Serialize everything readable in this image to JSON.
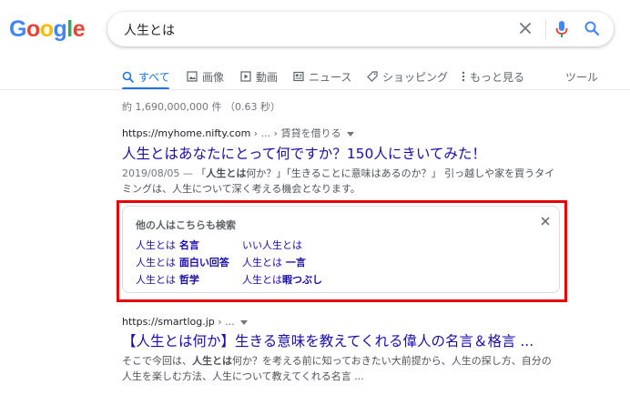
{
  "logo": {
    "letters": [
      "G",
      "o",
      "o",
      "g",
      "l",
      "e"
    ],
    "colors": [
      "#4285f4",
      "#ea4335",
      "#fbbc05",
      "#4285f4",
      "#34a853",
      "#ea4335"
    ]
  },
  "search": {
    "query": "人生とは"
  },
  "tabs": [
    {
      "label": "すべて",
      "icon": "search-icon"
    },
    {
      "label": "画像",
      "icon": "image-icon"
    },
    {
      "label": "動画",
      "icon": "video-icon"
    },
    {
      "label": "ニュース",
      "icon": "news-icon"
    },
    {
      "label": "ショッピング",
      "icon": "tag-icon"
    },
    {
      "label": "もっと見る",
      "icon": "more-icon"
    },
    {
      "label": "ツール",
      "icon": ""
    }
  ],
  "stats": "約 1,690,000,000 件 （0.63 秒）",
  "result1": {
    "domain": "https://myhome.nifty.com",
    "breadcrumb": " › ... › 賃貸を借りる",
    "title": "人生とはあなたにとって何ですか？150人にきいてみた！",
    "date": "2019/08/05 — ",
    "snippet_a": "「",
    "snippet_b1": "人生とは",
    "snippet_c": "何か？」「生きることに意味はあるのか？」 引っ越しや家を買うタイミングは、人生について深く考える機会となります。"
  },
  "paa": {
    "title": "他の人はこちらも検索",
    "links": [
      {
        "bold": "人生とは",
        "rest": " 名言"
      },
      {
        "bold": "人生とは",
        "rest": " 面白い回答"
      },
      {
        "bold": "人生とは",
        "rest": " 哲学"
      },
      {
        "bold": "いい人生とは",
        "rest": ""
      },
      {
        "bold": "人生とは",
        "rest": " 一言"
      },
      {
        "bold": "人生とは",
        "rest": "暇つぶし"
      }
    ]
  },
  "result2": {
    "domain": "https://smartlog.jp",
    "breadcrumb": " › ...",
    "title": "【人生とは何か】生きる意味を教えてくれる偉人の名言＆格言 ...",
    "snippet_a": "そこで今回は、",
    "snippet_b": "人生とは",
    "snippet_c": "何か？を考える前に知っておきたい大前提から、人生の探し方、自分の人生を楽しむ方法、人生について教えてくれる名言 ..."
  }
}
